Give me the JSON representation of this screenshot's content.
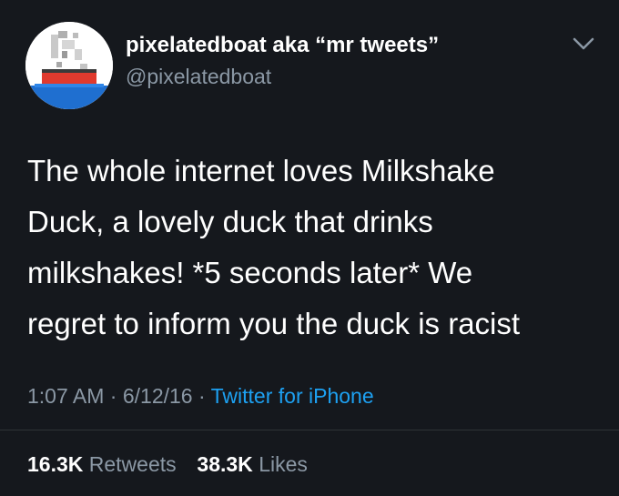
{
  "author": {
    "display_name": "pixelatedboat aka “mr tweets”",
    "handle": "@pixelatedboat",
    "avatar_icon": "pixel-boat-avatar"
  },
  "tweet": {
    "text_lines": [
      "The whole internet loves Milkshake",
      "Duck, a lovely duck that drinks",
      "milkshakes! *5 seconds later* We",
      "regret to inform you the duck is racist"
    ],
    "time": "1:07 AM",
    "separator": "·",
    "date": "6/12/16",
    "source": "Twitter for iPhone"
  },
  "stats": {
    "retweets_count": "16.3K",
    "retweets_label": "Retweets",
    "likes_count": "38.3K",
    "likes_label": "Likes"
  },
  "colors": {
    "background": "#15181d",
    "primary_text": "#ffffff",
    "secondary_text": "#8b98a5",
    "link": "#1da1f2"
  }
}
